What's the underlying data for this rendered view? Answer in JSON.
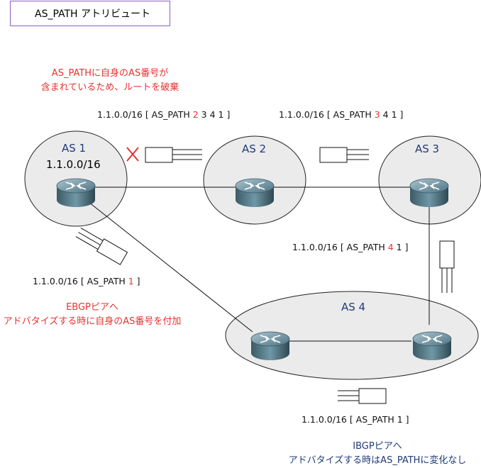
{
  "title": "AS_PATH アトリビュート",
  "notes": {
    "discard_line1": "AS_PATHに自身のAS番号が",
    "discard_line2": "含まれているため、ルートを破棄",
    "ebgp_line1": "EBGPピアへ",
    "ebgp_line2": "アドバタイズする時に自身のAS番号を付加",
    "ibgp_line1": "IBGPピアへ",
    "ibgp_line2": "アドバタイズする時はAS_PATHに変化なし"
  },
  "as_labels": {
    "as1": "AS 1",
    "as2": "AS 2",
    "as3": "AS 3",
    "as4": "AS 4"
  },
  "as1_prefix": "1.1.0.0/16",
  "paths": {
    "p1": {
      "pre": "1.1.0.0/16  [ AS_PATH ",
      "hl": "2",
      "post": " 3 4 1 ]"
    },
    "p2": {
      "pre": "1.1.0.0/16  [ AS_PATH ",
      "hl": "3",
      "post": " 4 1 ]"
    },
    "p3": {
      "pre": "1.1.0.0/16  [ AS_PATH ",
      "hl": "4",
      "post": " 1 ]"
    },
    "p4": {
      "pre": "1.1.0.0/16  [ AS_PATH ",
      "hl": "1",
      "post": " ]"
    },
    "p5": {
      "pre": "1.1.0.0/16  [ AS_PATH 1 ]",
      "hl": "",
      "post": ""
    }
  },
  "colors": {
    "red": "#e8312f",
    "blue": "#1f3a7a",
    "cloud_fill": "#ebebeb",
    "title_border": "#8a5fbf"
  },
  "icons": {
    "router": "router-icon",
    "packet": "packet-icon",
    "reject": "reject-x-icon"
  }
}
